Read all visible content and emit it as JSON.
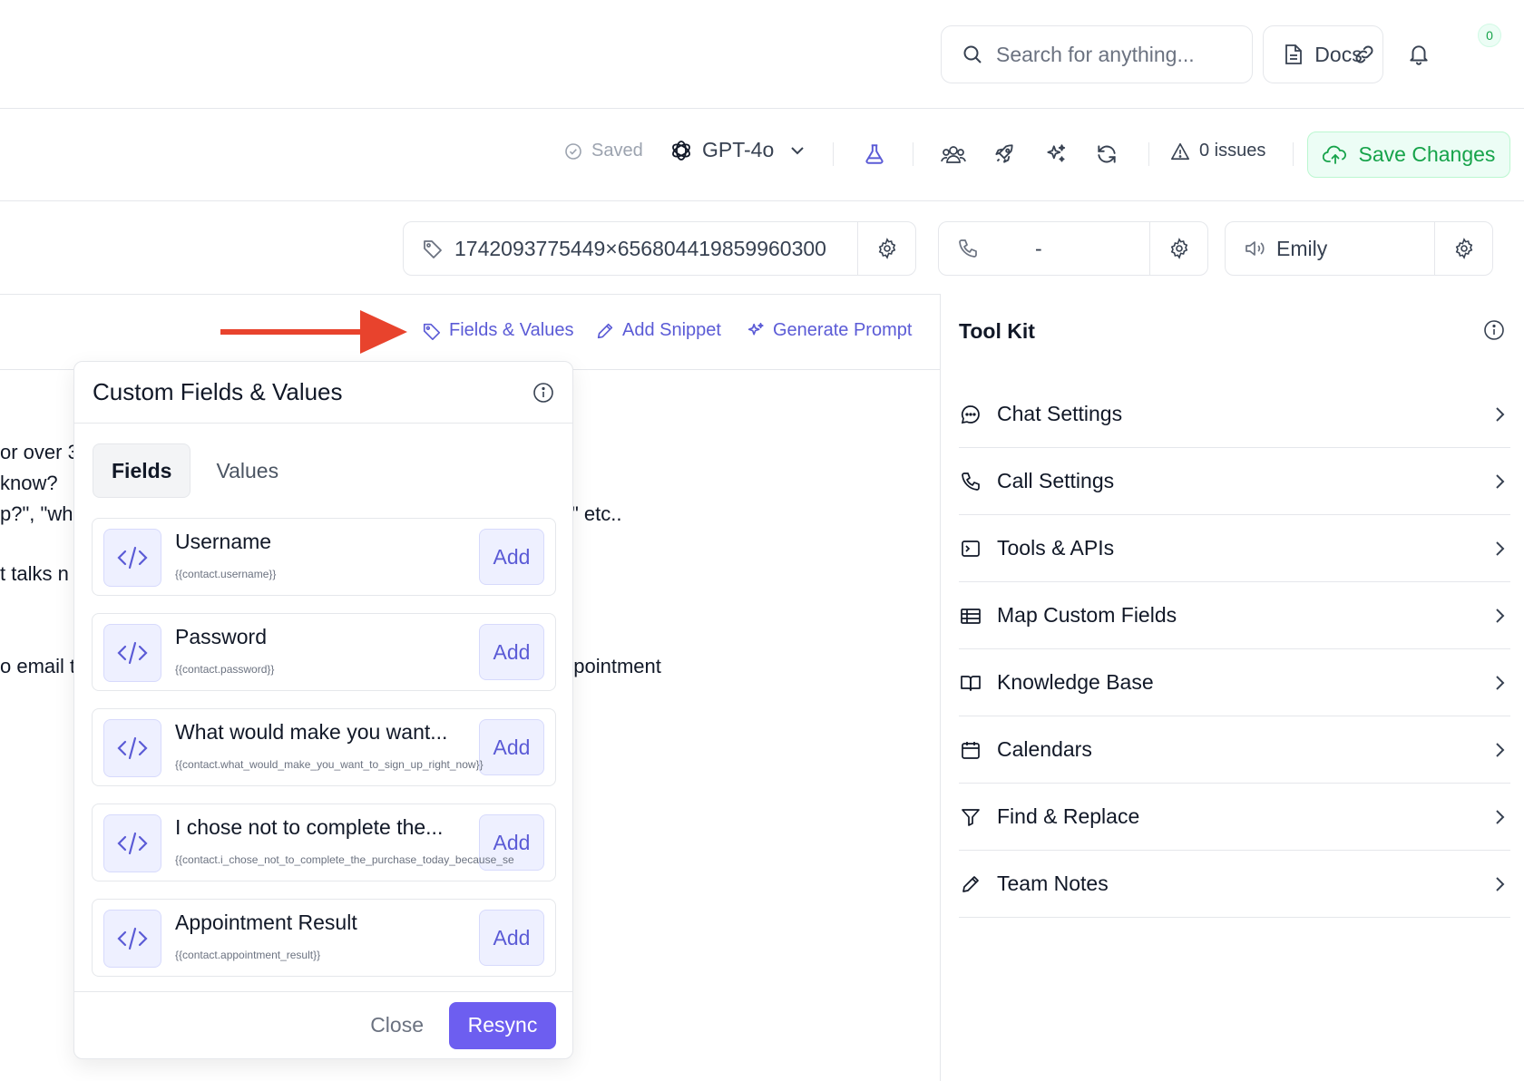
{
  "header": {
    "search_placeholder": "Search for anything...",
    "docs_label": "Docs",
    "notifications_count": "0"
  },
  "toolbar": {
    "saved_label": "Saved",
    "model_label": "GPT-4o",
    "issues_label": "0 issues",
    "save_label": "Save Changes"
  },
  "config": {
    "tag_value": "1742093775449×656804419859960300",
    "phone_value": "-",
    "voice_value": "Emily"
  },
  "editor": {
    "actions": {
      "fields_values": "Fields & Values",
      "add_snippet": "Add Snippet",
      "generate_prompt": "Generate Prompt"
    },
    "fragments": [
      "or over 3",
      "know?",
      "p?\", \"wh",
      "\" etc..",
      "t talks n",
      "o email t",
      "ppointment"
    ]
  },
  "popup": {
    "title": "Custom Fields & Values",
    "tabs": [
      "Fields",
      "Values"
    ],
    "add_label": "Add",
    "fields": [
      {
        "name": "Username",
        "key": "{{contact.username}}"
      },
      {
        "name": "Password",
        "key": "{{contact.password}}"
      },
      {
        "name": "What would make you want...",
        "key": "{{contact.what_would_make_you_want_to_sign_up_right_now}}"
      },
      {
        "name": "I chose not to complete the...",
        "key": "{{contact.i_chose_not_to_complete_the_purchase_today_because_se"
      },
      {
        "name": "Appointment Result",
        "key": "{{contact.appointment_result}}"
      }
    ],
    "close_label": "Close",
    "resync_label": "Resync"
  },
  "toolkit": {
    "title": "Tool Kit",
    "items": [
      {
        "label": "Chat Settings",
        "icon": "chat-bubble-icon"
      },
      {
        "label": "Call Settings",
        "icon": "phone-icon"
      },
      {
        "label": "Tools & APIs",
        "icon": "terminal-icon"
      },
      {
        "label": "Map Custom Fields",
        "icon": "table-icon"
      },
      {
        "label": "Knowledge Base",
        "icon": "book-icon"
      },
      {
        "label": "Calendars",
        "icon": "calendar-icon"
      },
      {
        "label": "Find & Replace",
        "icon": "filter-icon"
      },
      {
        "label": "Team Notes",
        "icon": "pencil-icon"
      }
    ]
  },
  "colors": {
    "accent": "#5b5bd6",
    "save_green": "#16a34a",
    "annotation_arrow": "#e8432d"
  }
}
